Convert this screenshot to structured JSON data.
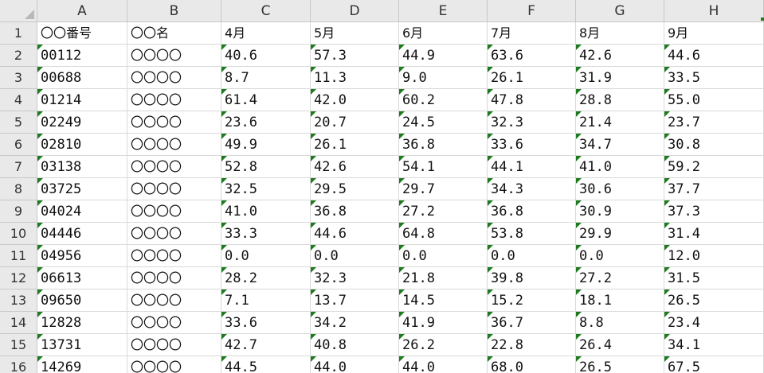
{
  "columns": [
    "A",
    "B",
    "C",
    "D",
    "E",
    "F",
    "G",
    "H"
  ],
  "header_row": [
    "〇〇番号",
    "〇〇名",
    "4月",
    "5月",
    "6月",
    "7月",
    "8月",
    "9月"
  ],
  "rows": [
    {
      "id": "00112",
      "name": "〇〇〇〇",
      "values": [
        "40.6",
        "57.3",
        "44.9",
        "63.6",
        "42.6",
        "44.6"
      ]
    },
    {
      "id": "00688",
      "name": "〇〇〇〇",
      "values": [
        "8.7",
        "11.3",
        "9.0",
        "26.1",
        "31.9",
        "33.5"
      ]
    },
    {
      "id": "01214",
      "name": "〇〇〇〇",
      "values": [
        "61.4",
        "42.0",
        "60.2",
        "47.8",
        "28.8",
        "55.0"
      ]
    },
    {
      "id": "02249",
      "name": "〇〇〇〇",
      "values": [
        "23.6",
        "20.7",
        "24.5",
        "32.3",
        "21.4",
        "23.7"
      ]
    },
    {
      "id": "02810",
      "name": "〇〇〇〇",
      "values": [
        "49.9",
        "26.1",
        "36.8",
        "33.6",
        "34.7",
        "30.8"
      ]
    },
    {
      "id": "03138",
      "name": "〇〇〇〇",
      "values": [
        "52.8",
        "42.6",
        "54.1",
        "44.1",
        "41.0",
        "59.2"
      ]
    },
    {
      "id": "03725",
      "name": "〇〇〇〇",
      "values": [
        "32.5",
        "29.5",
        "29.7",
        "34.3",
        "30.6",
        "37.7"
      ]
    },
    {
      "id": "04024",
      "name": "〇〇〇〇",
      "values": [
        "41.0",
        "36.8",
        "27.2",
        "36.8",
        "30.9",
        "37.3"
      ]
    },
    {
      "id": "04446",
      "name": "〇〇〇〇",
      "values": [
        "33.3",
        "44.6",
        "64.8",
        "53.8",
        "29.9",
        "31.4"
      ]
    },
    {
      "id": "04956",
      "name": "〇〇〇〇",
      "values": [
        "0.0",
        "0.0",
        "0.0",
        "0.0",
        "0.0",
        "12.0"
      ]
    },
    {
      "id": "06613",
      "name": "〇〇〇〇",
      "values": [
        "28.2",
        "32.3",
        "21.8",
        "39.8",
        "27.2",
        "31.5"
      ]
    },
    {
      "id": "09650",
      "name": "〇〇〇〇",
      "values": [
        "7.1",
        "13.7",
        "14.5",
        "15.2",
        "18.1",
        "26.5"
      ]
    },
    {
      "id": "12828",
      "name": "〇〇〇〇",
      "values": [
        "33.6",
        "34.2",
        "41.9",
        "36.7",
        "8.8",
        "23.4"
      ]
    },
    {
      "id": "13731",
      "name": "〇〇〇〇",
      "values": [
        "42.7",
        "40.8",
        "26.2",
        "22.8",
        "26.4",
        "34.1"
      ]
    },
    {
      "id": "14269",
      "name": "〇〇〇〇",
      "values": [
        "44.5",
        "44.0",
        "44.0",
        "68.0",
        "26.5",
        "67.5"
      ]
    }
  ],
  "colors": {
    "header_bg": "#e9e9e9",
    "error_triangle": "#1e7a1e",
    "gridline": "#d9d9d9"
  }
}
